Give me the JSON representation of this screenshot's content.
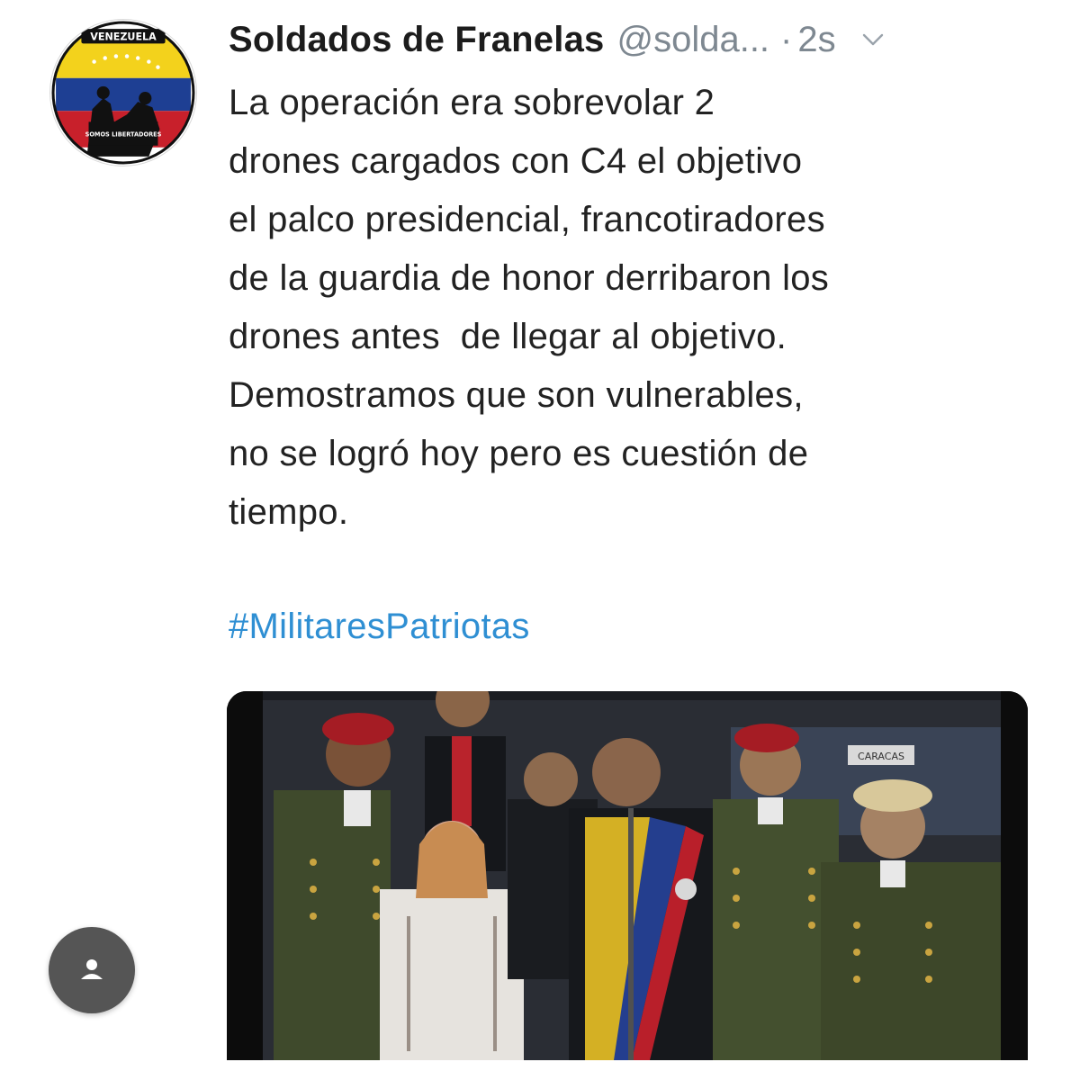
{
  "tweet": {
    "display_name": "Soldados de Franelas",
    "handle": "@solda...",
    "separator": "·",
    "timestamp": "2s",
    "menu_icon": "chevron-down-icon",
    "text_lines": [
      "La operación era sobrevolar 2",
      "drones cargados con C4 el objetivo",
      "el palco presidencial, francotiradores",
      "de la guardia de honor derribaron los",
      "drones antes  de llegar al objetivo.",
      "Demostramos que son vulnerables,",
      "no se logró hoy pero es cuestión de",
      "tiempo."
    ],
    "hashtag": "#MilitaresPatriotas"
  },
  "avatar": {
    "logo_text_top": "VENEZUELA",
    "logo_text_bottom": "SOMOS LIBERTADORES",
    "colors": {
      "yellow": "#f3d21c",
      "blue": "#1e3f93",
      "red": "#c8202b"
    }
  },
  "media": {
    "type": "video-thumbnail",
    "sign_text": "CARACAS"
  },
  "fab": {
    "icon": "user-icon",
    "color": "#555555"
  },
  "colors": {
    "text": "#222222",
    "muted": "#7e8891",
    "link": "#2f8fd3"
  }
}
